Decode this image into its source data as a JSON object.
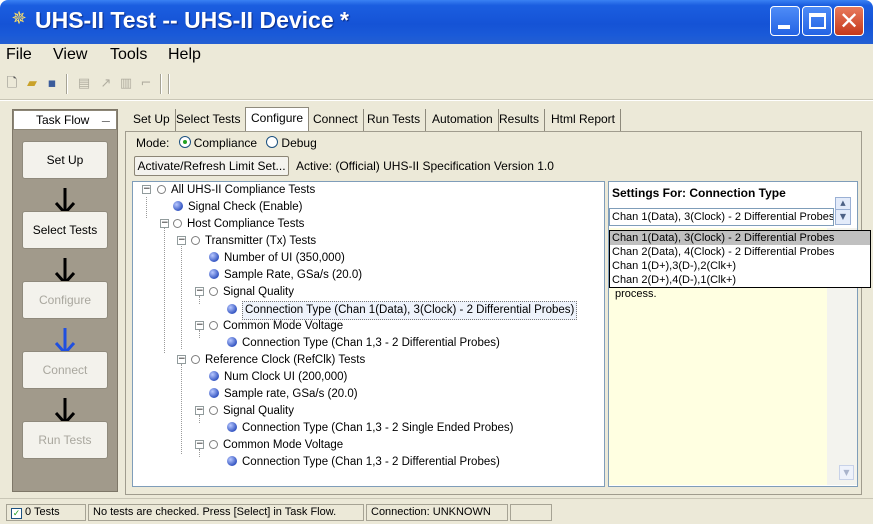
{
  "window": {
    "title": "UHS-II Test -- UHS-II Device *"
  },
  "menu": {
    "items": [
      "File",
      "View",
      "Tools",
      "Help"
    ]
  },
  "taskflow": {
    "header": "Task Flow",
    "steps": [
      {
        "label": "Set Up",
        "enabled": true
      },
      {
        "label": "Select Tests",
        "enabled": true
      },
      {
        "label": "Configure",
        "enabled": false
      },
      {
        "label": "Connect",
        "enabled": false
      },
      {
        "label": "Run Tests",
        "enabled": false
      }
    ],
    "arrow_colors": [
      "#000000",
      "#000000",
      "#1f4fe0",
      "#000000"
    ]
  },
  "tabs": [
    "Set Up",
    "Select Tests",
    "Configure",
    "Connect",
    "Run Tests",
    "Automation",
    "Results",
    "Html Report"
  ],
  "active_tab": "Configure",
  "mode": {
    "label": "Mode:",
    "options": [
      "Compliance",
      "Debug"
    ],
    "selected": "Compliance"
  },
  "activate_button": "Activate/Refresh Limit Set...",
  "active_limit": "Active: (Official) UHS-II Specification Version 1.0",
  "tree": [
    {
      "text": "All UHS-II Compliance Tests",
      "kind": "group",
      "level": 0
    },
    {
      "text": "Signal Check (Enable)",
      "kind": "leaf",
      "level": 1
    },
    {
      "text": "Host Compliance Tests",
      "kind": "group",
      "level": 1
    },
    {
      "text": "Transmitter (Tx) Tests",
      "kind": "group",
      "level": 2
    },
    {
      "text": "Number of UI (350,000)",
      "kind": "leaf",
      "level": 3
    },
    {
      "text": "Sample Rate, GSa/s (20.0)",
      "kind": "leaf",
      "level": 3
    },
    {
      "text": "Signal Quality",
      "kind": "group",
      "level": 3
    },
    {
      "text": "Connection Type (Chan 1(Data), 3(Clock) - 2 Differential Probes)",
      "kind": "leaf",
      "level": 4,
      "selected": true
    },
    {
      "text": "Common Mode Voltage",
      "kind": "group",
      "level": 3
    },
    {
      "text": "Connection Type (Chan 1,3 - 2 Differential Probes)",
      "kind": "leaf",
      "level": 4
    },
    {
      "text": "Reference Clock (RefClk) Tests",
      "kind": "group",
      "level": 2
    },
    {
      "text": "Num Clock UI (200,000)",
      "kind": "leaf",
      "level": 3
    },
    {
      "text": "Sample rate, GSa/s (20.0)",
      "kind": "leaf",
      "level": 3
    },
    {
      "text": "Signal Quality",
      "kind": "group",
      "level": 3
    },
    {
      "text": "Connection Type (Chan 1,3 - 2 Single Ended Probes)",
      "kind": "leaf",
      "level": 4
    },
    {
      "text": "Common Mode Voltage",
      "kind": "group",
      "level": 3
    },
    {
      "text": "Connection Type (Chan 1,3 - 2 Differential Probes)",
      "kind": "leaf",
      "level": 4
    }
  ],
  "settings": {
    "header": "Settings For: Connection Type",
    "combo_value": "Chan 1(Data), 3(Clock) - 2 Differential Probes",
    "options": [
      "Chan 1(Data), 3(Clock) - 2 Differential Probes",
      "Chan 2(Data), 4(Clock) - 2 Differential Probes",
      "Chan 1(D+),3(D-),2(Clk+)",
      "Chan 2(D+),4(D-),1(Clk+)"
    ],
    "highlighted_option": 0,
    "description_fragment": "process."
  },
  "status": {
    "tests": "0 Tests",
    "message": "No tests are checked. Press [Select] in Task Flow.",
    "connection": "Connection: UNKNOWN"
  }
}
